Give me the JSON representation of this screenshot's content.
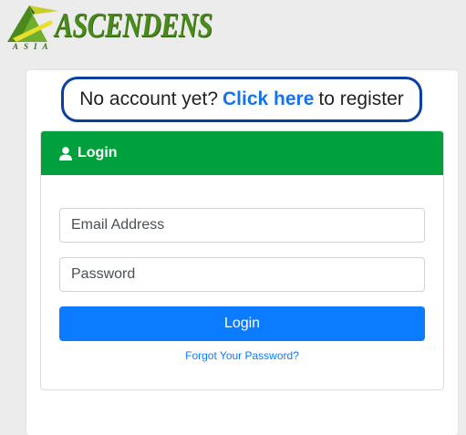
{
  "brand": {
    "name": "ASCENDENS",
    "sub": "ASIA",
    "primary_color": "#4a8a1c"
  },
  "register": {
    "prefix": "No account yet?",
    "link": "Click here",
    "suffix": "to register",
    "border_color": "#0a3f9e",
    "link_color": "#1674e8"
  },
  "login": {
    "title": "Login",
    "header_color": "#00a03c",
    "email_placeholder": "Email Address",
    "password_placeholder": "Password",
    "button_label": "Login",
    "button_color": "#0b7bff",
    "forgot_label": "Forgot Your Password?",
    "user_icon": "user-icon"
  }
}
